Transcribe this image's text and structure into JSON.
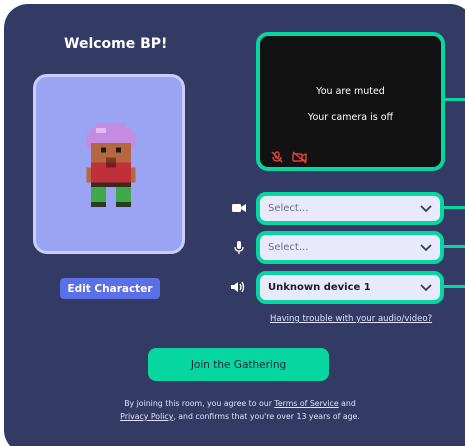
{
  "header": {
    "welcome": "Welcome BP!"
  },
  "character": {
    "edit_label": "Edit Character"
  },
  "preview": {
    "muted_text": "You are muted",
    "camera_text": "Your camera is off"
  },
  "devices": {
    "camera": {
      "value": "Select..."
    },
    "microphone": {
      "value": "Select..."
    },
    "speaker": {
      "value": "Unknown device 1"
    }
  },
  "trouble_link": "Having trouble with your audio/video?",
  "join_label": "Join the Gathering",
  "footer": {
    "part1": "By joining this room, you agree to our ",
    "terms": "Terms of Service",
    "part2": " and",
    "privacy": "Privacy Policy",
    "part3": ", and confirms that you're over 13 years of age."
  },
  "colors": {
    "panel": "#333a64",
    "accent": "#06d6a0",
    "avatar_bg": "#9aa4f2",
    "edit_button": "#5b6fe6",
    "muted_icon": "#e0403a"
  },
  "icons": [
    "mic-off-icon",
    "camera-off-icon",
    "video-camera-icon",
    "microphone-icon",
    "speaker-icon",
    "chevron-down-icon"
  ]
}
